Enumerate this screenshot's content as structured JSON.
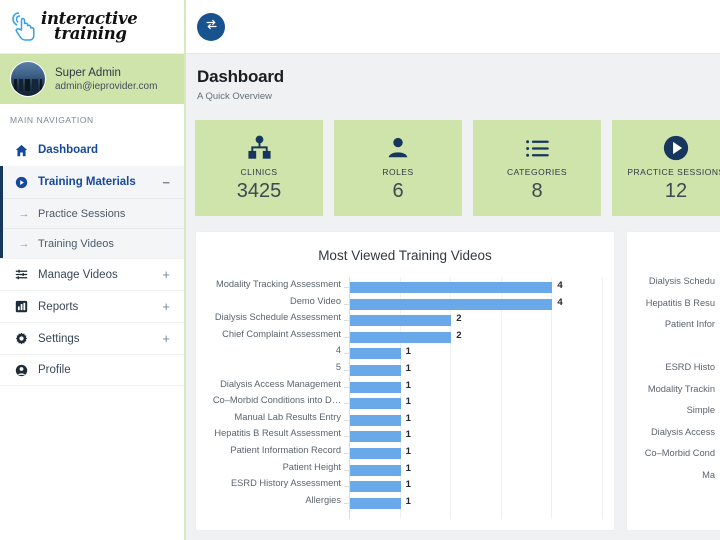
{
  "sidebar": {
    "logo": {
      "line1": "interactive",
      "line2": "training",
      "icon": "hand-pointer-icon"
    },
    "user": {
      "name": "Super Admin",
      "email": "admin@ieprovider.com"
    },
    "nav_heading": "MAIN NAVIGATION",
    "items": [
      {
        "label": "Dashboard",
        "icon": "home-icon",
        "active": true
      },
      {
        "label": "Training Materials",
        "icon": "play-circle-icon",
        "expander": "−",
        "active": true
      },
      {
        "label": "Practice Sessions",
        "icon": "arrow-right-icon",
        "sub": true
      },
      {
        "label": "Training Videos",
        "icon": "arrow-right-icon",
        "sub": true
      },
      {
        "label": "Manage Videos",
        "icon": "sliders-icon",
        "expander": "+"
      },
      {
        "label": "Reports",
        "icon": "chart-bar-icon",
        "expander": "+"
      },
      {
        "label": "Settings",
        "icon": "gear-icon",
        "expander": "+"
      },
      {
        "label": "Profile",
        "icon": "user-icon"
      }
    ]
  },
  "topbar": {
    "toggle_icon": "exchange-arrows-icon"
  },
  "header": {
    "title": "Dashboard",
    "subtitle": "A Quick Overview"
  },
  "cards": [
    {
      "label": "CLINICS",
      "value": "3425",
      "icon": "sitemap-icon"
    },
    {
      "label": "ROLES",
      "value": "6",
      "icon": "user-icon"
    },
    {
      "label": "CATEGORIES",
      "value": "8",
      "icon": "list-icon"
    },
    {
      "label": "PRACTICE SESSIONS",
      "value": "12",
      "icon": "play-circle-icon"
    }
  ],
  "colors": {
    "card_bg": "#cfe4ab",
    "icon_navy": "#17365d",
    "bar_blue": "#6aa9e9",
    "accent_blue": "#16489c",
    "page_bg": "#f0f1f2"
  },
  "chart_data": [
    {
      "type": "bar",
      "orientation": "horizontal",
      "title": "Most Viewed Training Videos",
      "xlabel": "",
      "ylabel": "",
      "xlim": [
        0,
        5
      ],
      "grid": true,
      "categories": [
        "Modality Tracking Assessment",
        "Demo Video",
        "Dialysis Schedule Assessment",
        "Chief Complaint Assessment",
        "4",
        "5",
        "Dialysis Access Management",
        "Co–Morbid Conditions into D…",
        "Manual Lab Results Entry",
        "Hepatitis B Result Assessment",
        "Patient Information Record",
        "Patient Height",
        "ESRD History Assessment",
        "Allergies"
      ],
      "values": [
        4,
        4,
        2,
        2,
        1,
        1,
        1,
        1,
        1,
        1,
        1,
        1,
        1,
        1
      ],
      "data_labels": [
        "4",
        "4",
        "2",
        "2",
        "1",
        "1",
        "1",
        "1",
        "1",
        "1",
        "1",
        "1",
        "1",
        "1"
      ]
    },
    {
      "type": "bar",
      "orientation": "horizontal",
      "title": "",
      "clipped": true,
      "categories": [
        "Dialysis Schedu",
        "Hepatitis B Resu",
        "Patient Infor",
        "",
        "ESRD Histo",
        "Modality Trackin",
        "Simple",
        "Dialysis Access",
        "Co–Morbid Cond",
        "Ma"
      ],
      "values": [
        null,
        null,
        null,
        null,
        null,
        null,
        null,
        null,
        null,
        null
      ]
    }
  ]
}
